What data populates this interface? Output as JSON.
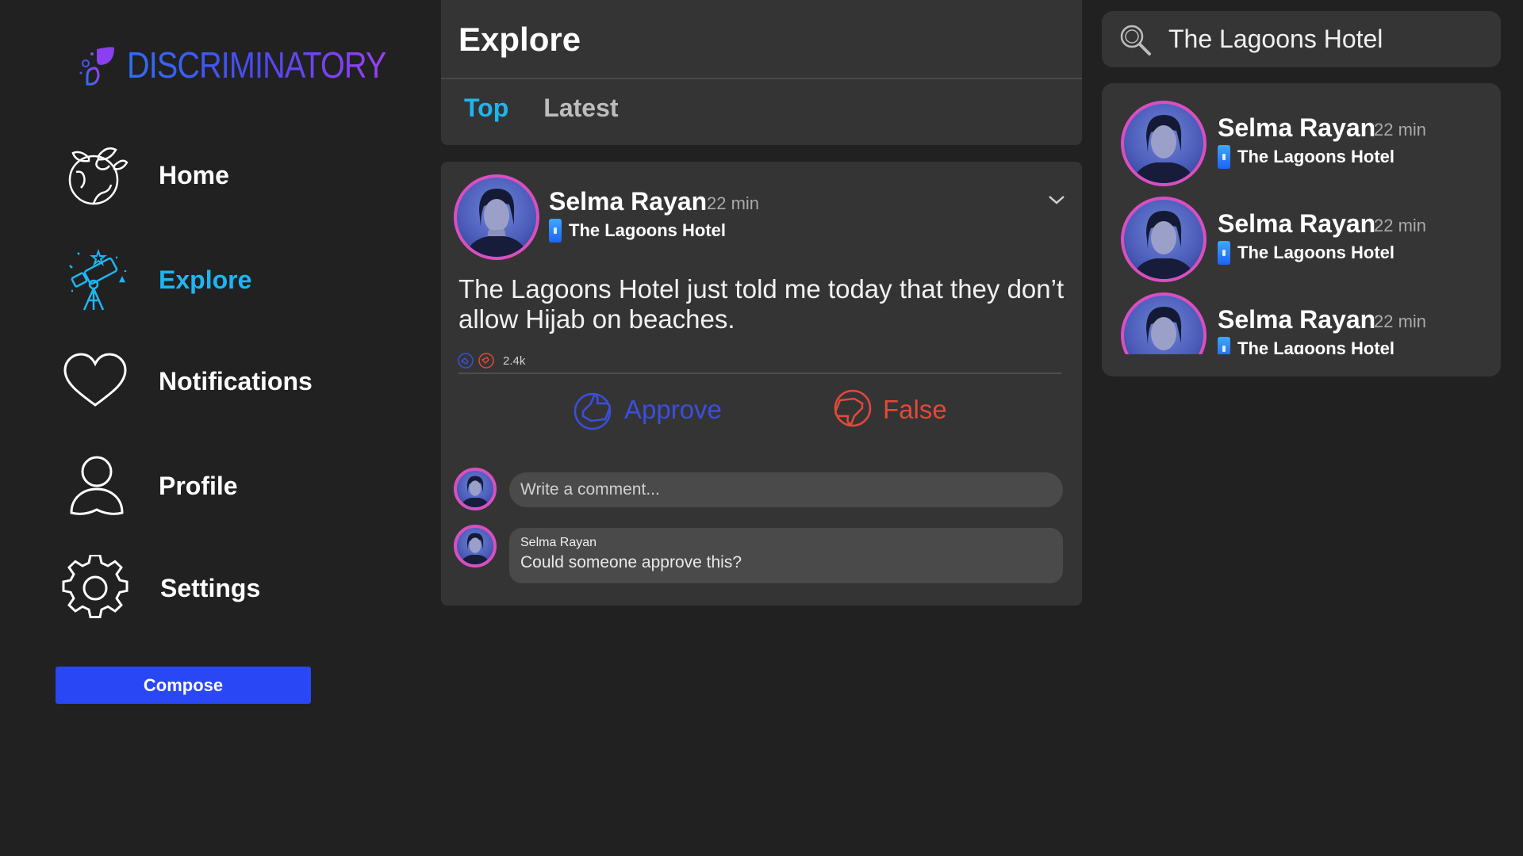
{
  "app": {
    "logo_text": "DISCRIMINATORY",
    "accent_color": "#1db6f2",
    "brand_gradient": [
      "#2f6ff0",
      "#9a3ff0"
    ]
  },
  "sidebar": {
    "items": [
      {
        "label": "Home",
        "icon": "globe-leaf-icon",
        "active": false
      },
      {
        "label": "Explore",
        "icon": "telescope-icon",
        "active": true
      },
      {
        "label": "Notifications",
        "icon": "heart-icon",
        "active": false
      },
      {
        "label": "Profile",
        "icon": "user-icon",
        "active": false
      },
      {
        "label": "Settings",
        "icon": "gear-icon",
        "active": false
      }
    ],
    "compose_label": "Compose"
  },
  "header": {
    "title": "Explore",
    "tabs": [
      {
        "label": "Top",
        "active": true
      },
      {
        "label": "Latest",
        "active": false
      }
    ]
  },
  "post": {
    "author": "Selma Rayan",
    "time": "22 min",
    "location": "The Lagoons Hotel",
    "text": "The Lagoons Hotel just told me today that they don’t allow Hijab on beaches.",
    "reaction_count": "2.4k",
    "approve_label": "Approve",
    "false_label": "False",
    "approve_color": "#3b4fd9",
    "false_color": "#e3483a",
    "comment_placeholder": "Write a comment...",
    "comments": [
      {
        "author": "Selma Rayan",
        "text": "Could someone approve this?"
      }
    ]
  },
  "search": {
    "value": "The Lagoons Hotel"
  },
  "results": [
    {
      "name": "Selma Rayan",
      "time": "22 min",
      "location": "The Lagoons Hotel"
    },
    {
      "name": "Selma Rayan",
      "time": "22 min",
      "location": "The Lagoons Hotel"
    },
    {
      "name": "Selma Rayan",
      "time": "22 min",
      "location": "The Lagoons Hotel"
    }
  ]
}
